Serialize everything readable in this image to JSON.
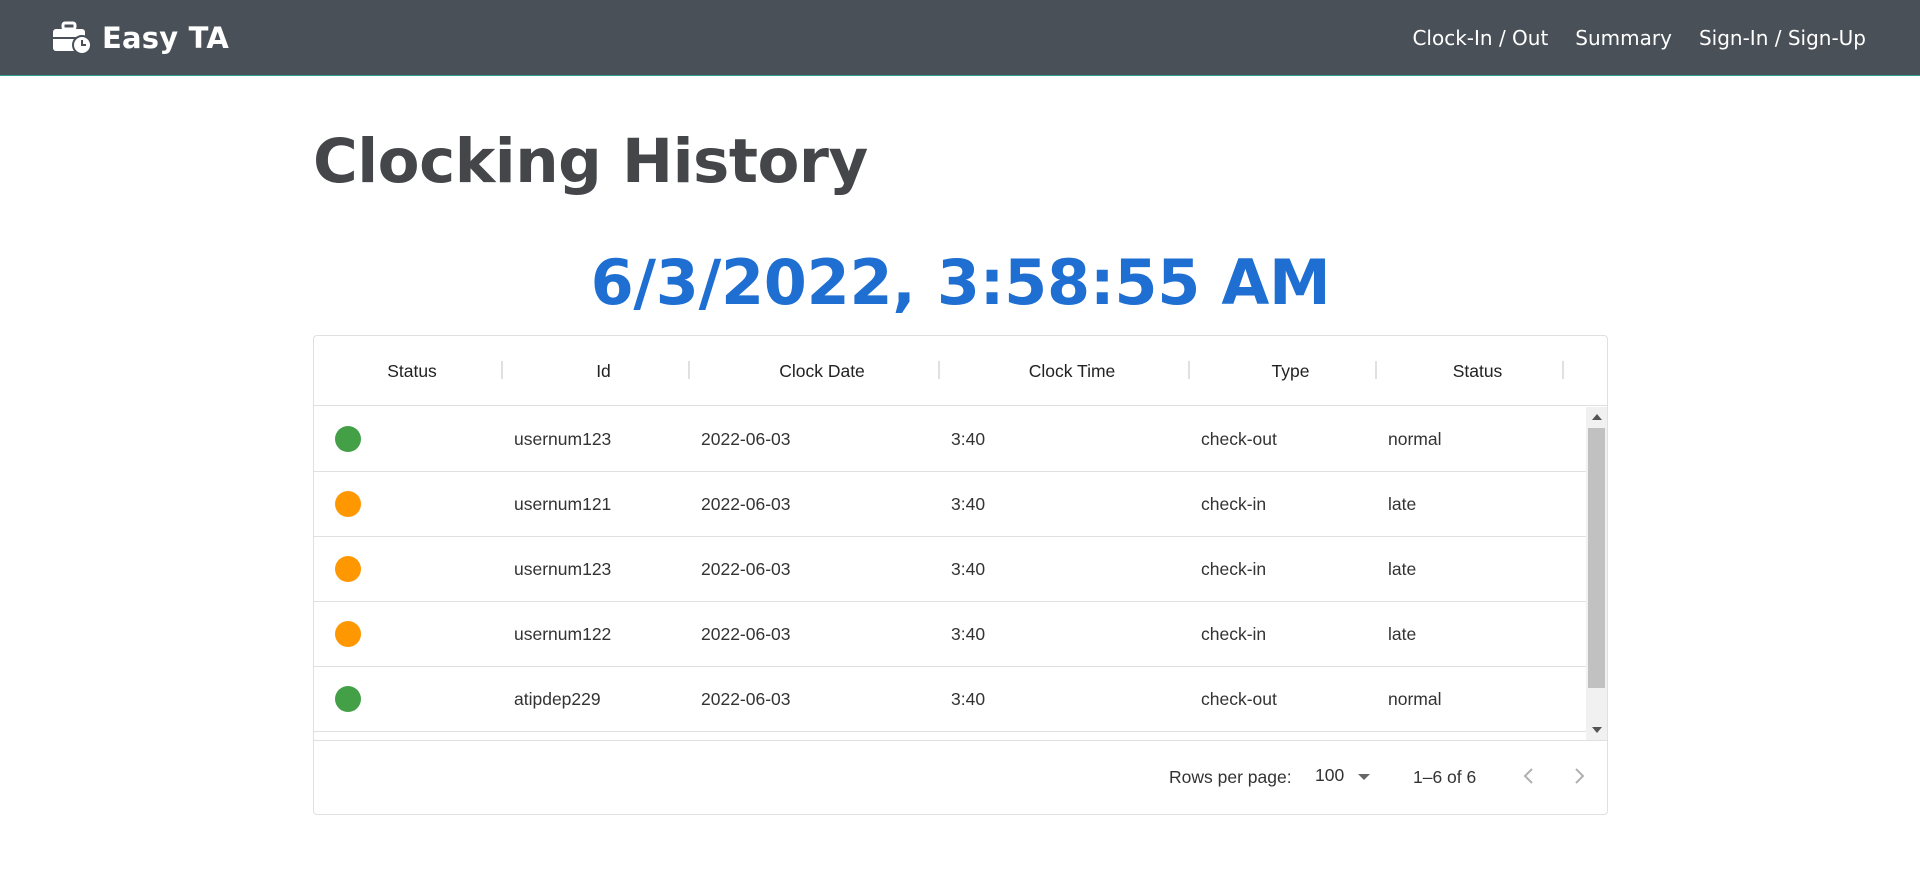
{
  "navbar": {
    "brand": "Easy TA",
    "links": [
      "Clock-In / Out",
      "Summary",
      "Sign-In / Sign-Up"
    ]
  },
  "page": {
    "title": "Clocking History",
    "clock_text": "6/3/2022, 3:58:55 AM"
  },
  "grid": {
    "columns": [
      "Status",
      "Id",
      "Clock Date",
      "Clock Time",
      "Type",
      "Status"
    ],
    "rows": [
      {
        "status": "normal-green",
        "id": "usernum123",
        "date": "2022-06-03",
        "time": "3:40",
        "type": "check-out",
        "status_text": "normal"
      },
      {
        "status": "late-orange",
        "id": "usernum121",
        "date": "2022-06-03",
        "time": "3:40",
        "type": "check-in",
        "status_text": "late"
      },
      {
        "status": "late-orange",
        "id": "usernum123",
        "date": "2022-06-03",
        "time": "3:40",
        "type": "check-in",
        "status_text": "late"
      },
      {
        "status": "late-orange",
        "id": "usernum122",
        "date": "2022-06-03",
        "time": "3:40",
        "type": "check-in",
        "status_text": "late"
      },
      {
        "status": "normal-green",
        "id": "atipdep229",
        "date": "2022-06-03",
        "time": "3:40",
        "type": "check-out",
        "status_text": "normal"
      }
    ],
    "footer": {
      "rows_per_page_label": "Rows per page:",
      "rows_per_page_value": "100",
      "page_info": "1–6 of 6"
    }
  },
  "colors": {
    "navbar_bg": "#495057",
    "clock_blue": "#1e6fd1",
    "status_green": "#43a047",
    "status_orange": "#ff9800"
  },
  "icons": {
    "brand": "briefcase-clock-icon",
    "prev": "chevron-left-icon",
    "next": "chevron-right-icon",
    "select": "caret-down-icon"
  }
}
